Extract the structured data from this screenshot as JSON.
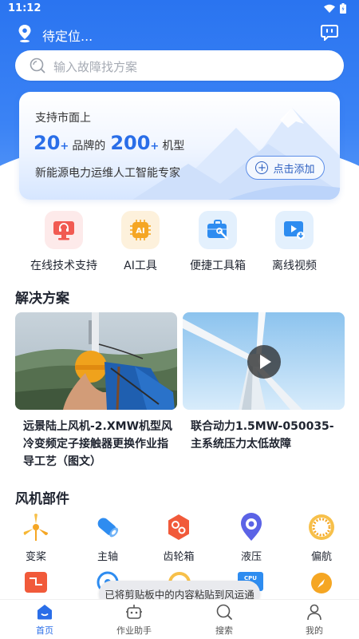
{
  "status_bar": {
    "time": "11:12"
  },
  "header": {
    "location": "待定位..."
  },
  "search": {
    "placeholder": "输入故障找方案"
  },
  "banner": {
    "line1": "支持市面上",
    "brands_count": "20",
    "brands_plus": "+",
    "brands_label": "品牌的",
    "models_count": "200",
    "models_plus": "+",
    "models_label": "机型",
    "line3": "新能源电力运维人工智能专家",
    "add_button": "点击添加"
  },
  "quick_actions": [
    {
      "label": "在线技术支持",
      "icon": "headset-monitor-icon",
      "color": "#f15a52"
    },
    {
      "label": "AI工具",
      "icon": "ai-icon",
      "color": "#f5a623"
    },
    {
      "label": "便捷工具箱",
      "icon": "toolbox-icon",
      "color": "#2e8cf0"
    },
    {
      "label": "离线视频",
      "icon": "video-download-icon",
      "color": "#2e8cf0"
    }
  ],
  "solutions": {
    "title": "解决方案",
    "cards": [
      {
        "title": "远景陆上风机-2.XMW机型风冷变频定子接触器更换作业指导工艺（图文）"
      },
      {
        "title": "联合动力1.5MW-050035-主系统压力太低故障"
      }
    ]
  },
  "parts": {
    "title": "风机部件",
    "items": [
      {
        "label": "变桨",
        "icon": "blade-icon"
      },
      {
        "label": "主轴",
        "icon": "shaft-icon"
      },
      {
        "label": "齿轮箱",
        "icon": "gearbox-icon"
      },
      {
        "label": "液压",
        "icon": "hydraulic-icon"
      },
      {
        "label": "偏航",
        "icon": "yaw-bearing-icon"
      }
    ]
  },
  "toast": "已将剪贴板中的内容粘贴到风运通",
  "tabs": [
    {
      "label": "首页",
      "icon": "home-icon",
      "active": true
    },
    {
      "label": "作业助手",
      "icon": "robot-icon",
      "active": false
    },
    {
      "label": "搜索",
      "icon": "search-icon",
      "active": false
    },
    {
      "label": "我的",
      "icon": "user-icon",
      "active": false
    }
  ]
}
